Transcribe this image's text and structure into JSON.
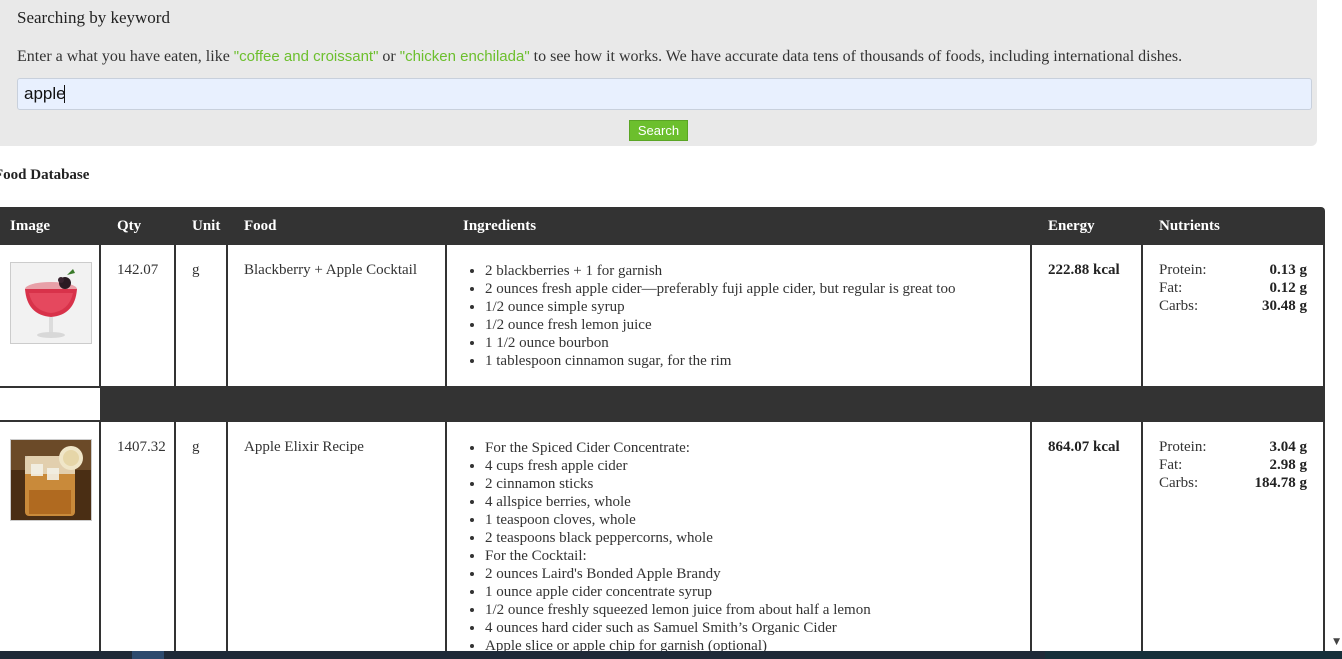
{
  "search": {
    "title": "Searching by keyword",
    "help_before": "Enter a what you have eaten, like ",
    "example1": "\"coffee and croissant\"",
    "help_or": " or ",
    "example2": "\"chicken enchilada\"",
    "help_after": " to see how it works. We have accurate data tens of thousands of foods, including international dishes.",
    "input_value": "apple",
    "button_label": "Search"
  },
  "section_heading": "Food Database",
  "table": {
    "headers": [
      "Image",
      "Qty",
      "Unit",
      "Food",
      "Ingredients",
      "Energy",
      "Nutrients"
    ],
    "rows": [
      {
        "image_icon": "cocktail-photo",
        "qty": "142.07",
        "unit": "g",
        "food": "Blackberry + Apple Cocktail",
        "ingredients": [
          "2 blackberries + 1 for garnish",
          "2 ounces fresh apple cider—preferably fuji apple cider, but regular is great too",
          "1/2 ounce simple syrup",
          "1/2 ounce fresh lemon juice",
          "1 1/2 ounce bourbon",
          "1 tablespoon cinnamon sugar, for the rim"
        ],
        "energy": "222.88 kcal",
        "nutrients": [
          {
            "label": "Protein:",
            "value": "0.13 g"
          },
          {
            "label": "Fat:",
            "value": "0.12 g"
          },
          {
            "label": "Carbs:",
            "value": "30.48 g"
          }
        ]
      },
      {
        "image_icon": "elixir-drink-photo",
        "qty": "1407.32",
        "unit": "g",
        "food": "Apple Elixir Recipe",
        "ingredients": [
          "For the Spiced Cider Concentrate:",
          "4 cups fresh apple cider",
          "2 cinnamon sticks",
          "4 allspice berries, whole",
          "1 teaspoon cloves, whole",
          "2 teaspoons black peppercorns, whole",
          "For the Cocktail:",
          "2 ounces Laird's Bonded Apple Brandy",
          "1 ounce apple cider concentrate syrup",
          "1/2 ounce freshly squeezed lemon juice from about half a lemon",
          "4 ounces hard cider such as Samuel Smith’s Organic Cider",
          "Apple slice or apple chip for garnish (optional)"
        ],
        "energy": "864.07 kcal",
        "nutrients": [
          {
            "label": "Protein:",
            "value": "3.04 g"
          },
          {
            "label": "Fat:",
            "value": "2.98 g"
          },
          {
            "label": "Carbs:",
            "value": "184.78 g"
          }
        ]
      }
    ]
  },
  "colors": {
    "accent": "#6cbf2d",
    "header_bg": "#333333",
    "panel_bg": "#e9e9e9",
    "input_bg": "#e8f0fe"
  }
}
